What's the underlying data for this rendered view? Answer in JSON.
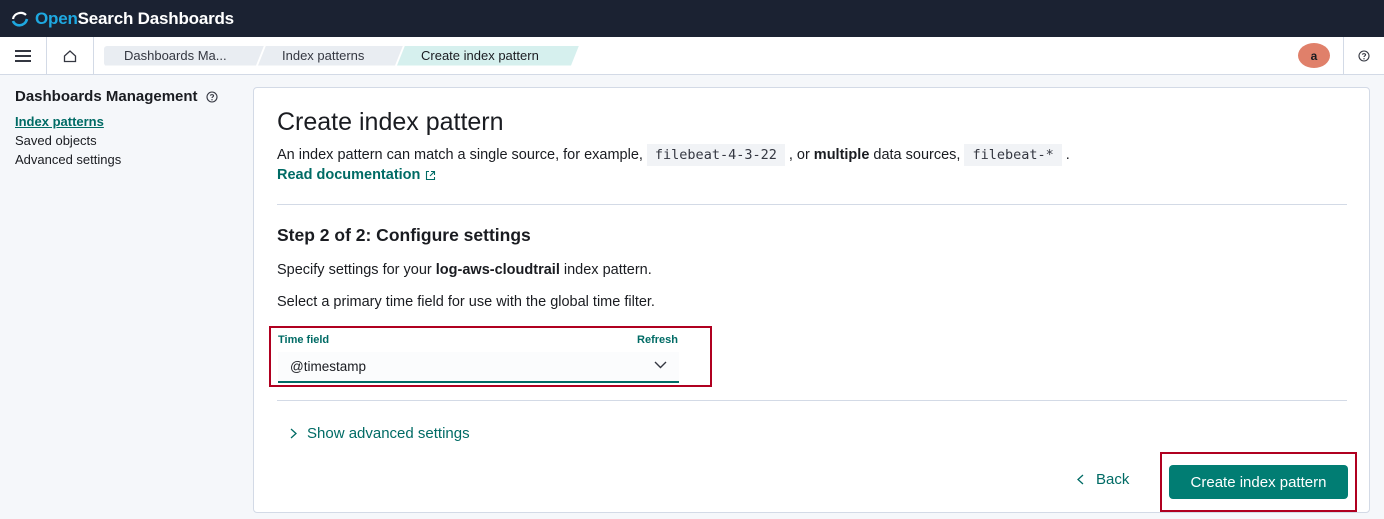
{
  "app": {
    "logo_open": "Open",
    "logo_rest": "Search Dashboards"
  },
  "breadcrumbs": [
    {
      "label": "Dashboards Ma..."
    },
    {
      "label": "Index patterns"
    },
    {
      "label": "Create index pattern"
    }
  ],
  "user": {
    "avatar_letter": "a"
  },
  "sidebar": {
    "title": "Dashboards Management",
    "items": [
      {
        "label": "Index patterns",
        "active": true
      },
      {
        "label": "Saved objects",
        "active": false
      },
      {
        "label": "Advanced settings",
        "active": false
      }
    ]
  },
  "main": {
    "title": "Create index pattern",
    "desc_prefix": "An index pattern can match a single source, for example,",
    "example_single": "filebeat-4-3-22",
    "desc_or": ", or",
    "desc_multiple": "multiple",
    "desc_mid": "data sources,",
    "example_multi": "filebeat-*",
    "desc_end": ".",
    "doc_link": "Read documentation",
    "step_title": "Step 2 of 2: Configure settings",
    "specify_prefix": "Specify settings for your",
    "pattern_name": "log-aws-cloudtrail",
    "specify_suffix": "index pattern.",
    "select_hint": "Select a primary time field for use with the global time filter.",
    "time_field_label": "Time field",
    "refresh_label": "Refresh",
    "time_field_value": "@timestamp",
    "advanced_label": "Show advanced settings",
    "back_label": "Back",
    "create_label": "Create index pattern"
  },
  "colors": {
    "header_bg": "#1b2232",
    "accent": "#006b65",
    "primary_button": "#017d73",
    "highlight_outline": "#b00020"
  }
}
